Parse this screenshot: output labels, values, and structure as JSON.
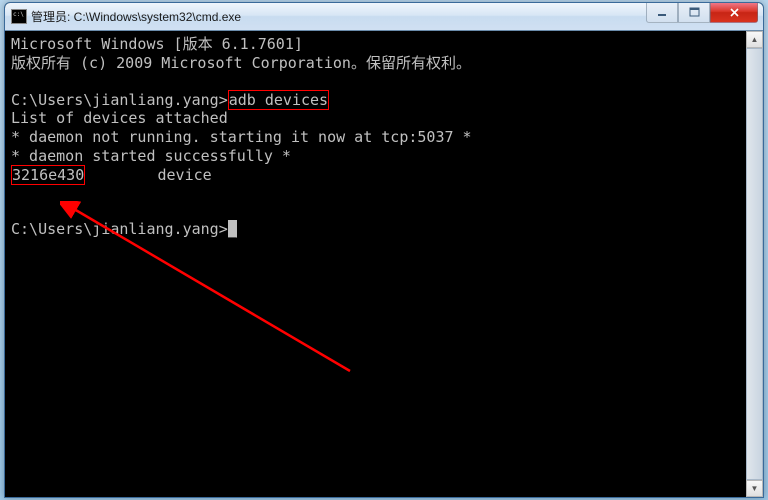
{
  "titlebar": {
    "title": "管理员: C:\\Windows\\system32\\cmd.exe"
  },
  "terminal": {
    "line1": "Microsoft Windows [版本 6.1.7601]",
    "line2": "版权所有 (c) 2009 Microsoft Corporation。保留所有权利。",
    "line3": "",
    "line4_prompt": "C:\\Users\\jianliang.yang>",
    "line4_cmd": "adb devices",
    "line5": "List of devices attached",
    "line6": "* daemon not running. starting it now at tcp:5037 *",
    "line7": "* daemon started successfully *",
    "line8_id": "3216e430",
    "line8_rest": "        device",
    "line9": "",
    "line10": "",
    "line11_prompt": "C:\\Users\\jianliang.yang>",
    "cursor": "_"
  },
  "colors": {
    "highlight": "#ff0000",
    "terminal_fg": "#c0c0c0",
    "terminal_bg": "#000000"
  }
}
